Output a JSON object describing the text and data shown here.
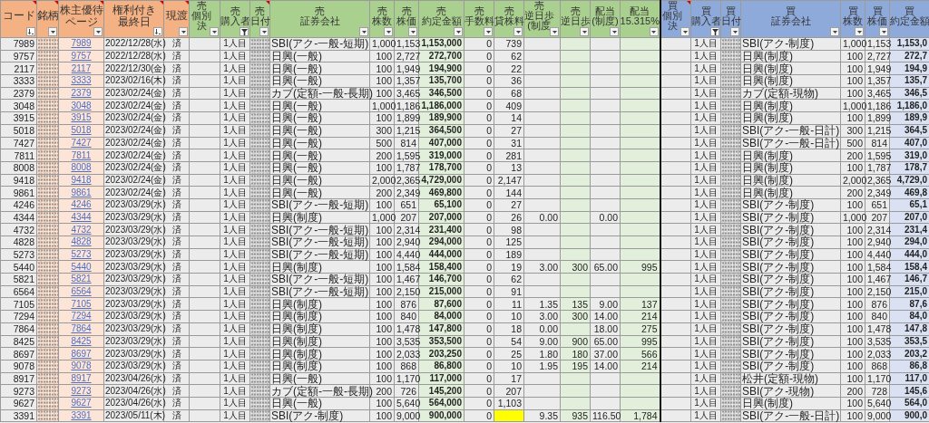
{
  "column_groups": [
    {
      "kind": "base",
      "columns": [
        {
          "lines": [
            "コード"
          ],
          "kind": "number",
          "filter_button": true,
          "sorted": true,
          "filtered": false,
          "comment": true
        },
        {
          "lines": [
            "銘柄"
          ],
          "kind": "hidden",
          "filter_button": true,
          "sorted": false,
          "filtered": false,
          "comment": true
        },
        {
          "lines": [
            "株主優待",
            "ページ"
          ],
          "kind": "link",
          "filter_button": true,
          "sorted": false,
          "filtered": false,
          "comment": true
        },
        {
          "lines": [
            "権利付き",
            "最終日"
          ],
          "kind": "center",
          "filter_button": true,
          "sorted": true,
          "filtered": false,
          "comment": true
        },
        {
          "lines": [
            "現渡"
          ],
          "kind": "center",
          "filter_button": true,
          "sorted": false,
          "filtered": false,
          "comment": true
        }
      ]
    },
    {
      "kind": "sell",
      "columns": [
        {
          "lines": [
            "売",
            "個別",
            "決"
          ],
          "kind": "center",
          "filter_button": true,
          "sorted": false,
          "filtered": false,
          "comment": false
        },
        {
          "lines": [
            "売",
            "購入者"
          ],
          "kind": "center",
          "filter_button": true,
          "sorted": false,
          "filtered": true,
          "comment": false
        },
        {
          "lines": [
            "売",
            "日付"
          ],
          "kind": "hidden",
          "filter_button": true,
          "sorted": false,
          "filtered": false,
          "comment": true
        },
        {
          "lines": [
            "売",
            "証券会社"
          ],
          "kind": "text",
          "filter_button": true,
          "sorted": false,
          "filtered": false,
          "comment": false
        },
        {
          "lines": [
            "売",
            "株数"
          ],
          "kind": "number",
          "filter_button": true,
          "sorted": false,
          "filtered": false,
          "comment": false
        },
        {
          "lines": [
            "売",
            "株価"
          ],
          "kind": "number",
          "filter_button": true,
          "sorted": false,
          "filtered": false,
          "comment": false
        },
        {
          "lines": [
            "売",
            "約定金額"
          ],
          "kind": "amount",
          "filter_button": true,
          "sorted": false,
          "filtered": false,
          "comment": false
        },
        {
          "lines": [
            "売",
            "手数料"
          ],
          "kind": "number",
          "filter_button": true,
          "sorted": false,
          "filtered": false,
          "comment": false
        },
        {
          "lines": [
            "売",
            "貸株料"
          ],
          "kind": "number",
          "filter_button": true,
          "sorted": false,
          "filtered": false,
          "comment": false
        },
        {
          "lines": [
            "売",
            "逆日歩",
            "(制度"
          ],
          "kind": "number",
          "filter_button": true,
          "sorted": false,
          "filtered": false,
          "comment": false
        },
        {
          "lines": [
            "売",
            "逆日歩"
          ],
          "kind": "shaded",
          "filter_button": true,
          "sorted": false,
          "filtered": false,
          "comment": false
        },
        {
          "lines": [
            "配当",
            "(制度)"
          ],
          "kind": "number",
          "filter_button": true,
          "sorted": false,
          "filtered": false,
          "comment": false
        },
        {
          "lines": [
            "配当",
            "15.315%"
          ],
          "kind": "shaded",
          "filter_button": true,
          "sorted": false,
          "filtered": false,
          "comment": false
        }
      ]
    },
    {
      "kind": "buy",
      "columns": [
        {
          "lines": [
            "買",
            "個別",
            "決"
          ],
          "kind": "center",
          "filter_button": true,
          "sorted": false,
          "filtered": false,
          "comment": true
        },
        {
          "lines": [
            "買",
            "購入者"
          ],
          "kind": "center",
          "filter_button": true,
          "sorted": false,
          "filtered": true,
          "comment": false
        },
        {
          "lines": [
            "買",
            "日付"
          ],
          "kind": "hidden",
          "filter_button": true,
          "sorted": false,
          "filtered": false,
          "comment": false
        },
        {
          "lines": [
            "買",
            "証券会社"
          ],
          "kind": "text",
          "filter_button": true,
          "sorted": false,
          "filtered": false,
          "comment": false
        },
        {
          "lines": [
            "買",
            "株数"
          ],
          "kind": "number",
          "filter_button": true,
          "sorted": false,
          "filtered": false,
          "comment": false
        },
        {
          "lines": [
            "買",
            "株価"
          ],
          "kind": "number",
          "filter_button": true,
          "sorted": false,
          "filtered": false,
          "comment": false
        },
        {
          "lines": [
            "買",
            "約定金額"
          ],
          "kind": "amount",
          "filter_button": false,
          "sorted": false,
          "filtered": false,
          "comment": false
        }
      ]
    }
  ],
  "rows": [
    {
      "cells": [
        "7989",
        "7989",
        "2022/12/28(水)",
        "済",
        null,
        "1人目",
        "SBI(アク-一般-短期)",
        "1,000",
        "1,153",
        "1,153,000",
        "0",
        "739",
        null,
        null,
        null,
        null,
        null,
        "1人目",
        "SBI(アク-制度)",
        "1,000",
        "1,153",
        "1,153,0"
      ]
    },
    {
      "cells": [
        "9757",
        "9757",
        "2022/12/28(水)",
        "済",
        null,
        "1人目",
        "日興(一般)",
        "100",
        "2,727",
        "272,700",
        "0",
        "62",
        null,
        null,
        null,
        null,
        null,
        "1人目",
        "日興(制度)",
        "100",
        "2,727",
        "272,7"
      ]
    },
    {
      "cells": [
        "2117",
        "2117",
        "2022/12/30(金)",
        "済",
        null,
        "1人目",
        "日興(一般)",
        "100",
        "1,949",
        "194,900",
        "0",
        "22",
        null,
        null,
        null,
        null,
        null,
        "1人目",
        "日興(制度)",
        "100",
        "1,949",
        "194,9"
      ]
    },
    {
      "cells": [
        "3333",
        "3333",
        "2023/02/16(木)",
        "済",
        null,
        "1人目",
        "日興(一般)",
        "100",
        "1,357",
        "135,700",
        "0",
        "36",
        null,
        null,
        null,
        null,
        null,
        "1人目",
        "日興(制度)",
        "100",
        "1,357",
        "135,7"
      ]
    },
    {
      "cells": [
        "2379",
        "2379",
        "2023/02/24(金)",
        "済",
        null,
        "1人目",
        "カブ(定額-一般-長期)",
        "100",
        "3,465",
        "346,500",
        "0",
        "68",
        null,
        null,
        null,
        null,
        null,
        "1人目",
        "カブ(定額-現物)",
        "100",
        "3,465",
        "346,5"
      ]
    },
    {
      "cells": [
        "3048",
        "3048",
        "2023/02/24(金)",
        "済",
        null,
        "1人目",
        "日興(一般)",
        "1,000",
        "1,186",
        "1,186,000",
        "0",
        "409",
        null,
        null,
        null,
        null,
        null,
        "1人目",
        "日興(制度)",
        "1,000",
        "1,186",
        "1,186,0"
      ]
    },
    {
      "cells": [
        "3915",
        "3915",
        "2023/02/24(金)",
        "済",
        null,
        "1人目",
        "日興(一般)",
        "100",
        "1,899",
        "189,900",
        "0",
        "14",
        null,
        null,
        null,
        null,
        null,
        "1人目",
        "日興(制度)",
        "100",
        "1,899",
        "189,9"
      ]
    },
    {
      "cells": [
        "5018",
        "5018",
        "2023/02/24(金)",
        "済",
        null,
        "1人目",
        "日興(一般)",
        "300",
        "1,215",
        "364,500",
        "0",
        "27",
        null,
        null,
        null,
        null,
        null,
        "1人目",
        "SBI(アク-一般-日計)",
        "300",
        "1,215",
        "364,5"
      ]
    },
    {
      "cells": [
        "7427",
        "7427",
        "2023/02/24(金)",
        "済",
        null,
        "1人目",
        "日興(一般)",
        "500",
        "814",
        "407,000",
        "0",
        "31",
        null,
        null,
        null,
        null,
        null,
        "1人目",
        "SBI(アク-一般-日計)",
        "500",
        "814",
        "407,0"
      ]
    },
    {
      "cells": [
        "7811",
        "7811",
        "2023/02/24(金)",
        "済",
        null,
        "1人目",
        "日興(一般)",
        "200",
        "1,595",
        "319,000",
        "0",
        "281",
        null,
        null,
        null,
        null,
        null,
        "1人目",
        "日興(制度)",
        "200",
        "1,595",
        "319,0"
      ]
    },
    {
      "cells": [
        "8008",
        "8008",
        "2023/02/24(金)",
        "済",
        null,
        "1人目",
        "日興(一般)",
        "100",
        "1,787",
        "178,700",
        "0",
        "13",
        null,
        null,
        null,
        null,
        null,
        "1人目",
        "日興(制度)",
        "100",
        "1,787",
        "178,7"
      ]
    },
    {
      "cells": [
        "9418",
        "9418",
        "2023/02/24(金)",
        "済",
        null,
        "1人目",
        "日興(一般)",
        "2,000",
        "2,365",
        "4,729,000",
        "0",
        "2,147",
        null,
        null,
        null,
        null,
        null,
        "1人目",
        "日興(制度)",
        "2,000",
        "2,365",
        "4,729,0"
      ]
    },
    {
      "cells": [
        "9861",
        "9861",
        "2023/02/24(金)",
        "済",
        null,
        "1人目",
        "日興(一般)",
        "200",
        "2,349",
        "469,800",
        "0",
        "144",
        null,
        null,
        null,
        null,
        null,
        "1人目",
        "日興(制度)",
        "200",
        "2,349",
        "469,8"
      ]
    },
    {
      "cells": [
        "4246",
        "4246",
        "2023/03/29(水)",
        "済",
        null,
        "1人目",
        "SBI(アク-一般-短期)",
        "100",
        "651",
        "65,100",
        "0",
        "27",
        null,
        null,
        null,
        null,
        null,
        "1人目",
        "SBI(アク-制度)",
        "100",
        "651",
        "65,1"
      ]
    },
    {
      "cells": [
        "4344",
        "4344",
        "2023/03/29(水)",
        "済",
        null,
        "1人目",
        "日興(制度)",
        "1,000",
        "207",
        "207,000",
        "0",
        "26",
        "0.00",
        null,
        "0.00",
        null,
        null,
        "1人目",
        "SBI(アク-制度)",
        "1,000",
        "207",
        "207,0"
      ]
    },
    {
      "cells": [
        "4732",
        "4732",
        "2023/03/29(水)",
        "済",
        null,
        "1人目",
        "SBI(アク-一般-短期)",
        "100",
        "2,314",
        "231,400",
        "0",
        "98",
        null,
        null,
        null,
        null,
        null,
        "1人目",
        "SBI(アク-制度)",
        "100",
        "2,314",
        "231,4"
      ]
    },
    {
      "cells": [
        "4828",
        "4828",
        "2023/03/29(水)",
        "済",
        null,
        "1人目",
        "SBI(アク-一般-短期)",
        "100",
        "2,940",
        "294,000",
        "0",
        "125",
        null,
        null,
        null,
        null,
        null,
        "1人目",
        "SBI(アク-制度)",
        "100",
        "2,940",
        "294,0"
      ]
    },
    {
      "cells": [
        "5273",
        "5273",
        "2023/03/29(水)",
        "済",
        null,
        "1人目",
        "SBI(アク-一般-短期)",
        "100",
        "4,440",
        "444,000",
        "0",
        "189",
        null,
        null,
        null,
        null,
        null,
        "1人目",
        "SBI(アク-制度)",
        "100",
        "4,440",
        "444,0"
      ]
    },
    {
      "cells": [
        "5440",
        "5440",
        "2023/03/29(水)",
        "済",
        null,
        "1人目",
        "日興(制度)",
        "100",
        "1,584",
        "158,400",
        "0",
        "19",
        "3.00",
        "300",
        "65.00",
        "995",
        null,
        "1人目",
        "SBI(アク-制度)",
        "100",
        "1,584",
        "158,4"
      ]
    },
    {
      "cells": [
        "5821",
        "5821",
        "2023/03/29(水)",
        "済",
        null,
        "1人目",
        "SBI(アク-一般-短期)",
        "100",
        "1,467",
        "146,700",
        "0",
        "62",
        null,
        null,
        null,
        null,
        null,
        "1人目",
        "SBI(アク-制度)",
        "100",
        "1,467",
        "146,7"
      ]
    },
    {
      "cells": [
        "6564",
        "6564",
        "2023/03/29(水)",
        "済",
        null,
        "1人目",
        "SBI(アク-一般-短期)",
        "100",
        "2,150",
        "215,000",
        "0",
        "91",
        null,
        null,
        null,
        null,
        null,
        "1人目",
        "SBI(アク-制度)",
        "100",
        "2,150",
        "215,0"
      ]
    },
    {
      "cells": [
        "7105",
        "7105",
        "2023/03/29(水)",
        "済",
        null,
        "1人目",
        "日興(制度)",
        "100",
        "876",
        "87,600",
        "0",
        "11",
        "1.35",
        "135",
        "9.00",
        "137",
        null,
        "1人目",
        "SBI(アク-制度)",
        "100",
        "876",
        "87,6"
      ]
    },
    {
      "cells": [
        "7294",
        "7294",
        "2023/03/29(水)",
        "済",
        null,
        "1人目",
        "日興(制度)",
        "100",
        "840",
        "84,000",
        "0",
        "10",
        "3.00",
        "300",
        "14.00",
        "214",
        null,
        "1人目",
        "SBI(アク-制度)",
        "100",
        "840",
        "84,0"
      ]
    },
    {
      "cells": [
        "7864",
        "7864",
        "2023/03/29(水)",
        "済",
        null,
        "1人目",
        "日興(制度)",
        "100",
        "1,478",
        "147,800",
        "0",
        "18",
        "0.00",
        null,
        "18.00",
        "275",
        null,
        "1人目",
        "SBI(アク-制度)",
        "100",
        "1,478",
        "147,8"
      ]
    },
    {
      "cells": [
        "8425",
        "8425",
        "2023/03/29(水)",
        "済",
        null,
        "1人目",
        "日興(制度)",
        "100",
        "3,535",
        "353,500",
        "0",
        "54",
        "9.00",
        "900",
        "65.00",
        "995",
        null,
        "1人目",
        "SBI(アク-制度)",
        "100",
        "3,535",
        "353,5"
      ]
    },
    {
      "cells": [
        "8697",
        "8697",
        "2023/03/29(水)",
        "済",
        null,
        "1人目",
        "日興(制度)",
        "100",
        "2,033",
        "203,250",
        "0",
        "25",
        "1.80",
        "180",
        "37.00",
        "566",
        null,
        "1人目",
        "SBI(アク-制度)",
        "100",
        "2,033",
        "203,2"
      ]
    },
    {
      "cells": [
        "9078",
        "9078",
        "2023/03/29(水)",
        "済",
        null,
        "1人目",
        "日興(制度)",
        "100",
        "868",
        "86,800",
        "0",
        "10",
        "1.95",
        "195",
        "14.00",
        "214",
        null,
        "1人目",
        "SBI(アク-制度)",
        "100",
        "868",
        "86,8"
      ]
    },
    {
      "cells": [
        "8917",
        "8917",
        "2023/04/26(水)",
        "済",
        null,
        "1人目",
        "日興(一般)",
        "100",
        "1,170",
        "117,000",
        "0",
        "17",
        null,
        null,
        null,
        null,
        null,
        "1人目",
        "松井(定額-現物)",
        "100",
        "1,170",
        "117,0"
      ]
    },
    {
      "cells": [
        "9273",
        "9273",
        "2023/04/26(水)",
        "済",
        null,
        "1人目",
        "カブ(定額-一般-長期)",
        "200",
        "726",
        "145,200",
        "0",
        "207",
        null,
        null,
        null,
        null,
        null,
        "1人目",
        "SBI(アク-現物)",
        "200",
        "728",
        "145,6"
      ]
    },
    {
      "cells": [
        "9627",
        "9627",
        "2023/04/26(水)",
        "済",
        null,
        "1人目",
        "日興(一般)",
        "100",
        "5,640",
        "564,000",
        "0",
        "1,103",
        null,
        null,
        null,
        null,
        null,
        "1人目",
        "日興(制度)",
        "100",
        "5,640",
        "564,0"
      ]
    },
    {
      "cells": [
        "3391",
        "3391",
        "2023/05/11(木)",
        "済",
        null,
        "1人目",
        "SBI(アク-制度)",
        "100",
        "9,000",
        "900,000",
        "0",
        {
          "highlighted": true
        },
        "9.35",
        "935",
        "116.50",
        "1,784",
        null,
        "1人目",
        "SBI(アク-一般-日計)",
        "100",
        "9,000",
        "900,0"
      ]
    }
  ]
}
